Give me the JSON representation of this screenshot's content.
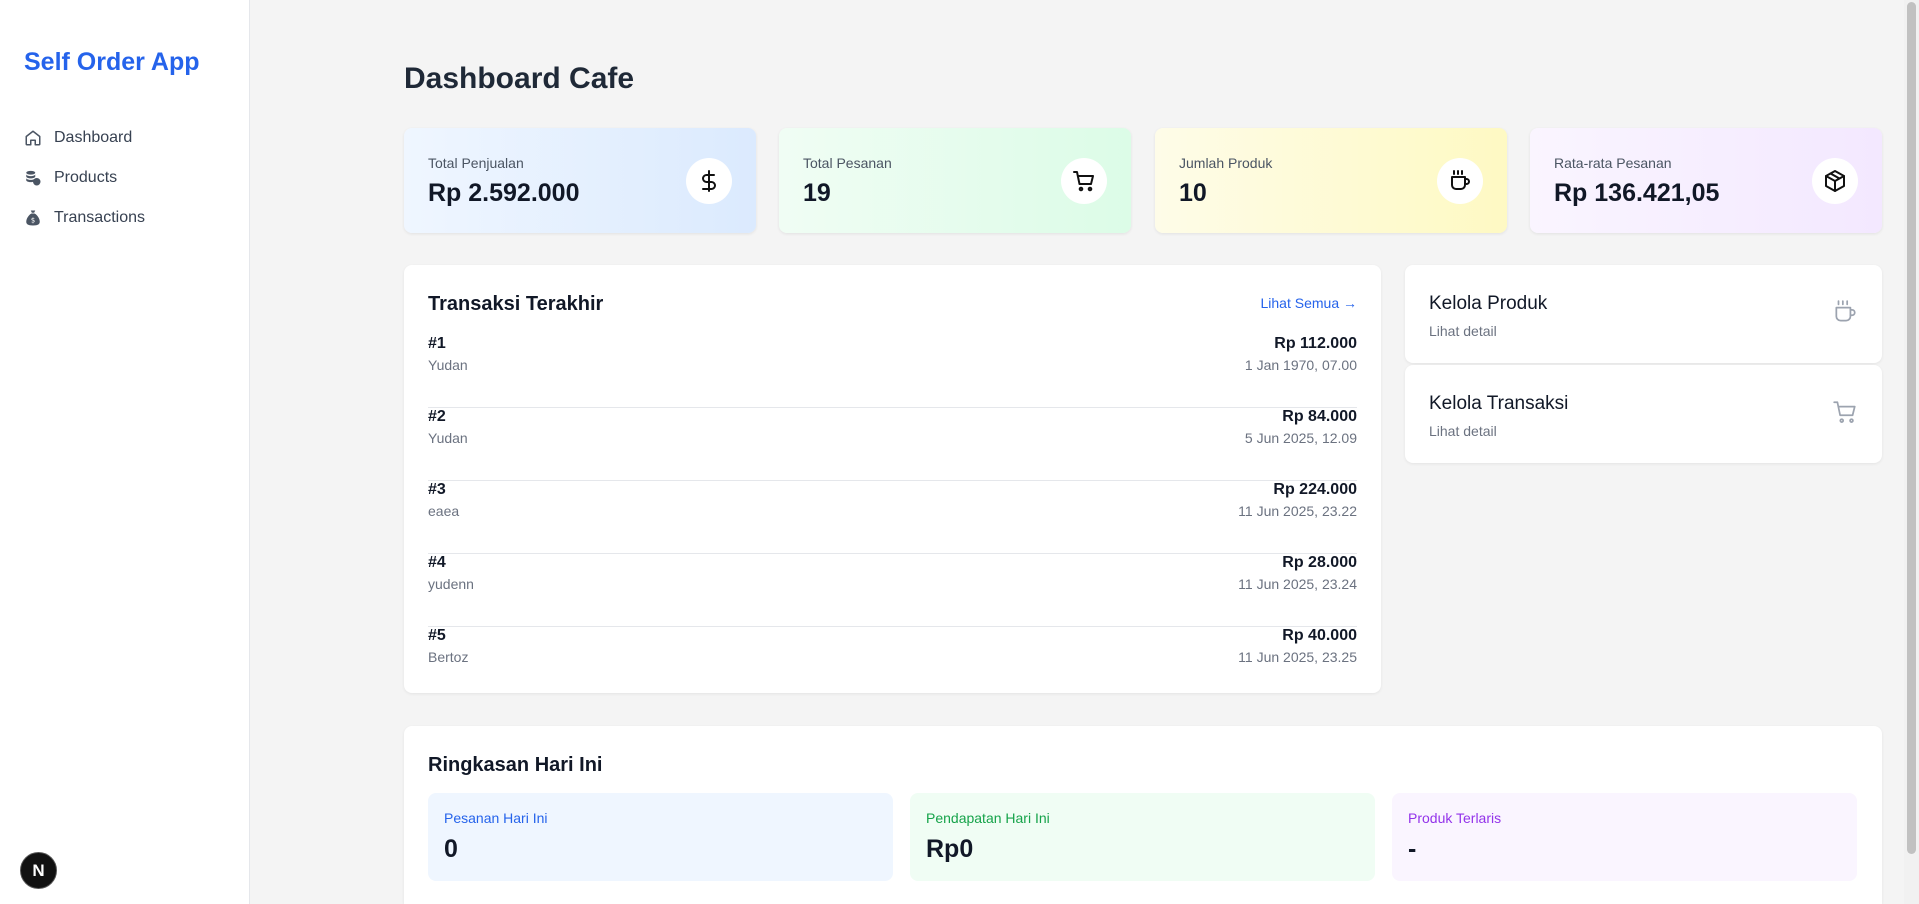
{
  "sidebar": {
    "brand": "Self Order App",
    "items": [
      {
        "label": "Dashboard",
        "icon": "home-icon"
      },
      {
        "label": "Products",
        "icon": "database-icon"
      },
      {
        "label": "Transactions",
        "icon": "money-bag-icon"
      }
    ],
    "badge": "N"
  },
  "page": {
    "title": "Dashboard Cafe"
  },
  "stats": [
    {
      "label": "Total Penjualan",
      "value": "Rp 2.592.000",
      "icon": "dollar-icon"
    },
    {
      "label": "Total Pesanan",
      "value": "19",
      "icon": "cart-icon"
    },
    {
      "label": "Jumlah Produk",
      "value": "10",
      "icon": "coffee-icon"
    },
    {
      "label": "Rata-rata Pesanan",
      "value": "Rp 136.421,05",
      "icon": "package-icon"
    }
  ],
  "transactions": {
    "title": "Transaksi Terakhir",
    "see_all": "Lihat Semua →",
    "rows": [
      {
        "id": "#1",
        "name": "Yudan",
        "amount": "Rp 112.000",
        "date": "1 Jan 1970, 07.00"
      },
      {
        "id": "#2",
        "name": "Yudan",
        "amount": "Rp 84.000",
        "date": "5 Jun 2025, 12.09"
      },
      {
        "id": "#3",
        "name": "eaea",
        "amount": "Rp 224.000",
        "date": "11 Jun 2025, 23.22"
      },
      {
        "id": "#4",
        "name": "yudenn",
        "amount": "Rp 28.000",
        "date": "11 Jun 2025, 23.24"
      },
      {
        "id": "#5",
        "name": "Bertoz",
        "amount": "Rp 40.000",
        "date": "11 Jun 2025, 23.25"
      }
    ]
  },
  "quick_links": [
    {
      "title": "Kelola Produk",
      "sub": "Lihat detail",
      "icon": "coffee-icon"
    },
    {
      "title": "Kelola Transaksi",
      "sub": "Lihat detail",
      "icon": "cart-icon"
    }
  ],
  "summary": {
    "title": "Ringkasan Hari Ini",
    "cards": [
      {
        "label": "Pesanan Hari Ini",
        "value": "0"
      },
      {
        "label": "Pendapatan Hari Ini",
        "value": "Rp0"
      },
      {
        "label": "Produk Terlaris",
        "value": "-"
      }
    ]
  },
  "colors": {
    "brand": "#2563eb",
    "green": "#16a34a",
    "purple": "#9333ea"
  }
}
